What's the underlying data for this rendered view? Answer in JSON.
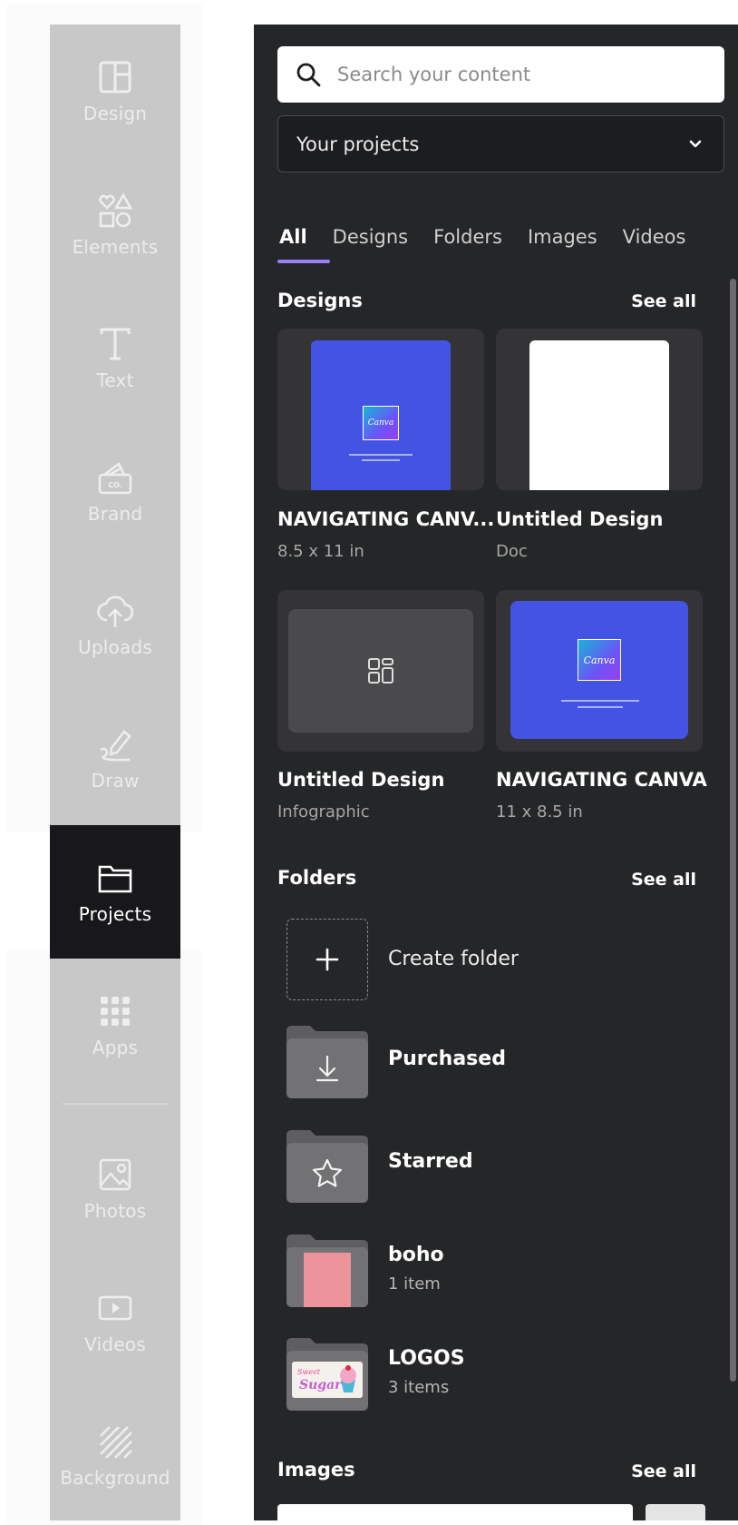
{
  "sidebar": {
    "items": [
      {
        "label": "Design",
        "icon": "layout-icon"
      },
      {
        "label": "Elements",
        "icon": "shapes-icon"
      },
      {
        "label": "Text",
        "icon": "text-icon"
      },
      {
        "label": "Brand",
        "icon": "brand-kit-icon"
      },
      {
        "label": "Uploads",
        "icon": "cloud-upload-icon"
      },
      {
        "label": "Draw",
        "icon": "pen-icon"
      },
      {
        "label": "Projects",
        "icon": "folder-icon",
        "active": true
      },
      {
        "label": "Apps",
        "icon": "apps-grid-icon"
      },
      {
        "label": "Photos",
        "icon": "photo-icon"
      },
      {
        "label": "Videos",
        "icon": "video-icon"
      },
      {
        "label": "Background",
        "icon": "background-pattern-icon"
      }
    ]
  },
  "panel": {
    "search": {
      "placeholder": "Search your content"
    },
    "project_filter": {
      "selected": "Your projects"
    },
    "tabs": [
      "All",
      "Designs",
      "Folders",
      "Images",
      "Videos"
    ],
    "active_tab": "All",
    "designs": {
      "title": "Designs",
      "see_all": "See all",
      "items": [
        {
          "title": "NAVIGATING CANV...",
          "subtitle": "8.5 x 11 in",
          "thumb": "canva-guide-portrait"
        },
        {
          "title": "Untitled Design",
          "subtitle": "Doc",
          "thumb": "blank-doc"
        },
        {
          "title": "Untitled Design",
          "subtitle": "Infographic",
          "thumb": "infographic-placeholder"
        },
        {
          "title": "NAVIGATING CANVA",
          "subtitle": "11 x 8.5 in",
          "thumb": "canva-guide-landscape"
        }
      ],
      "thumb_logo_text": "Canva"
    },
    "folders": {
      "title": "Folders",
      "see_all": "See all",
      "create_label": "Create folder",
      "items": [
        {
          "name": "Purchased",
          "subtitle": "",
          "icon": "download-icon"
        },
        {
          "name": "Starred",
          "subtitle": "",
          "icon": "star-icon"
        },
        {
          "name": "boho",
          "subtitle": "1 item",
          "icon": "pink-thumbnail"
        },
        {
          "name": "LOGOS",
          "subtitle": "3 items",
          "icon": "cupcake-logo-thumbnail"
        }
      ]
    },
    "images": {
      "title": "Images",
      "see_all": "See all"
    }
  },
  "colors": {
    "rail": "#c8c8c8",
    "rail_active": "#18181b",
    "panel": "#252627",
    "accent_underline": "#9b7ffb",
    "thumb_blue": "#4353e4"
  }
}
